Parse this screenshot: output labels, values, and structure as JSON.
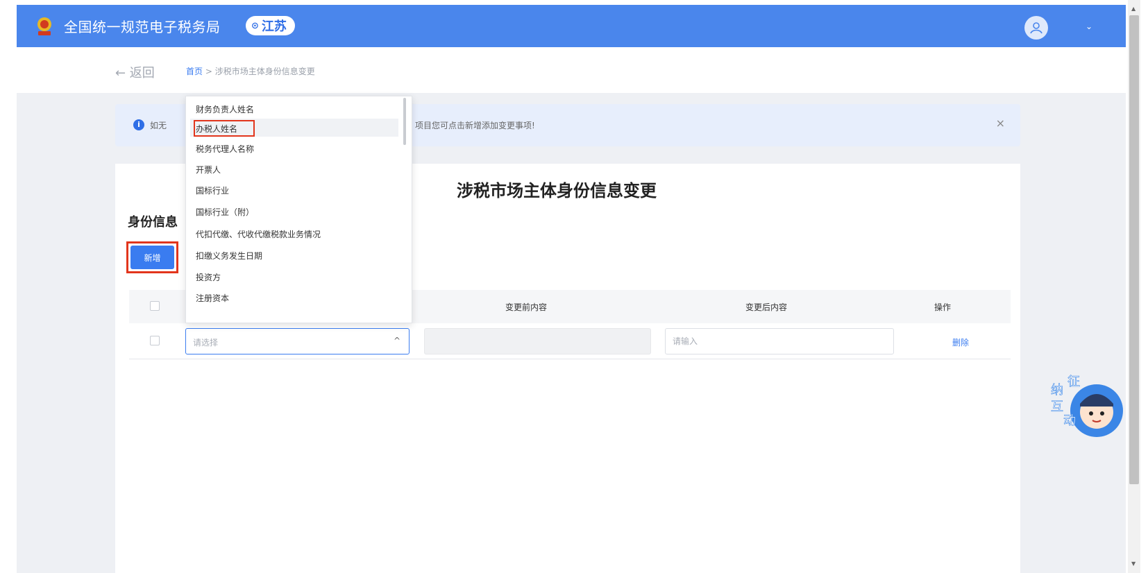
{
  "header": {
    "site_title": "全国统一规范电子税务局",
    "region": "江苏",
    "pin_icon": "location-pin-icon",
    "avatar_icon": "user-avatar-icon",
    "caret": "⌄"
  },
  "nav": {
    "back_label": "← 返回",
    "crumb_home": "首页",
    "crumb_sep": " > ",
    "crumb_current": "涉税市场主体身份信息变更"
  },
  "notice": {
    "icon": "info-icon",
    "text_left": "如无",
    "text_right": "项目您可点击新增添加变更事项!",
    "close": "×"
  },
  "page": {
    "title": "涉税市场主体身份信息变更",
    "section_title": "身份信息",
    "add_button": "新增"
  },
  "table": {
    "headers": {
      "before": "变更前内容",
      "after": "变更后内容",
      "action": "操作"
    },
    "row": {
      "select_placeholder": "请选择",
      "select_arrow": "^",
      "after_placeholder": "请输入",
      "delete_label": "删除"
    }
  },
  "dropdown": {
    "options": [
      "财务负责人姓名",
      "办税人姓名",
      "税务代理人名称",
      "开票人",
      "国标行业",
      "国标行业（附）",
      "代扣代缴、代收代缴税款业务情况",
      "扣缴义务发生日期",
      "投资方",
      "注册资本"
    ],
    "selected_index": 1
  },
  "mascot": {
    "chars": [
      "征",
      "纳",
      "互",
      "动"
    ]
  },
  "colors": {
    "header_blue": "#4a86ec",
    "primary": "#3a7cf0",
    "highlight_red": "#e2351c"
  }
}
